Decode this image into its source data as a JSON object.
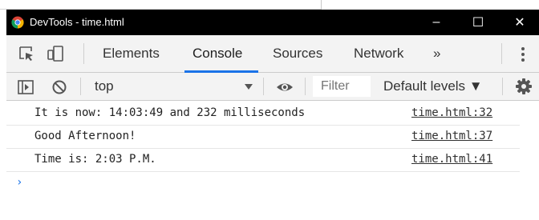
{
  "window": {
    "title": "DevTools - time.html"
  },
  "controls": {
    "minimize": "–",
    "maximize": "☐",
    "close": "✕"
  },
  "tabs": [
    {
      "label": "Elements",
      "active": false
    },
    {
      "label": "Console",
      "active": true
    },
    {
      "label": "Sources",
      "active": false
    },
    {
      "label": "Network",
      "active": false
    }
  ],
  "more_tabs": "»",
  "console_toolbar": {
    "context": "top",
    "filter_placeholder": "Filter",
    "levels": "Default levels ▼"
  },
  "messages": [
    {
      "text": "It is now: 14:03:49 and 232 milliseconds",
      "source": "time.html:32"
    },
    {
      "text": "Good Afternoon!",
      "source": "time.html:37"
    },
    {
      "text": "Time is: 2:03 P.M.",
      "source": "time.html:41"
    }
  ],
  "prompt": "›",
  "colors": {
    "accent": "#1a73e8",
    "titlebar": "#000000",
    "toolbar": "#f3f3f3"
  },
  "icons": [
    "chrome-logo-icon",
    "inspect-element-icon",
    "device-toolbar-icon",
    "kebab-menu-icon",
    "sidebar-toggle-icon",
    "clear-console-icon",
    "dropdown-arrow-icon",
    "eye-icon",
    "gear-icon"
  ]
}
